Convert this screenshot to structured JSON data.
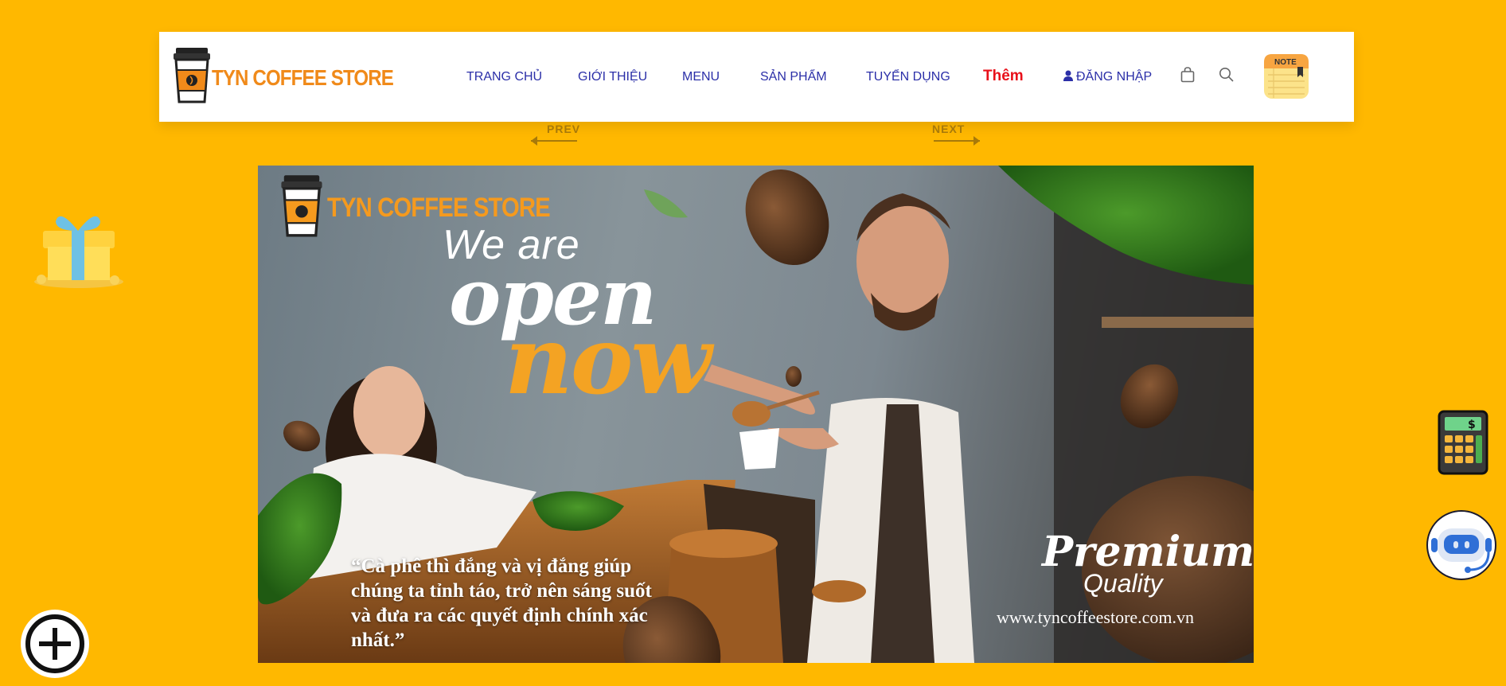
{
  "brand": {
    "name": "TYN COFFEE STORE"
  },
  "nav": {
    "items": [
      {
        "label": "TRANG CHỦ"
      },
      {
        "label": "GIỚI THIỆU"
      },
      {
        "label": "MENU"
      },
      {
        "label": "SẢN PHẨM"
      },
      {
        "label": "TUYỂN DỤNG"
      }
    ],
    "more": "Thêm",
    "login": "ĐĂNG NHẬP",
    "note_label": "NOTE"
  },
  "slider": {
    "prev": "PREV",
    "next": "NEXT"
  },
  "banner": {
    "brand": "TYN COFFEE STORE",
    "headline_1": "We are",
    "headline_2": "open",
    "headline_3": "now",
    "quote": "“Cà phê thì đắng và vị đắng giúp chúng ta tỉnh táo, trở nên sáng suốt và đưa ra các quyết định chính xác nhất.”",
    "premium": "Premium",
    "quality": "Quality",
    "url": "www.tyncoffeestore.com.vn"
  },
  "colors": {
    "page_bg": "#FFB800",
    "nav_text": "#2B2FA8",
    "more_text": "#E8101A",
    "brand_orange": "#F08A1A"
  },
  "icons": [
    "cart-icon",
    "search-icon",
    "user-icon",
    "note-icon",
    "gift-icon",
    "calculator-icon",
    "chatbot-icon",
    "plus-circle-icon"
  ]
}
